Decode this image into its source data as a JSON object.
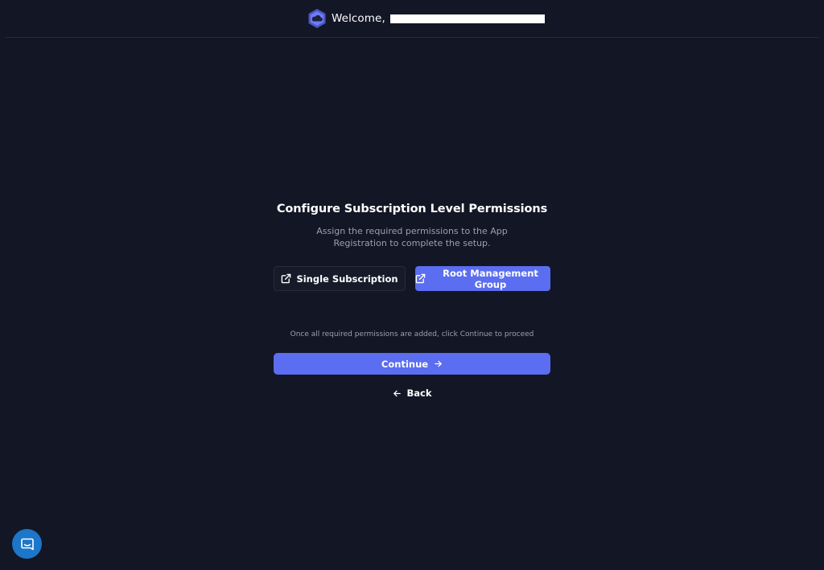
{
  "header": {
    "welcome_label": "Welcome,",
    "username": "",
    "logo_icon": "cloud-hexagon-icon",
    "brand_color": "#5b6df0"
  },
  "main": {
    "title": "Configure Subscription Level Permissions",
    "subtitle": "Assign the required permissions to the App Registration to complete the setup.",
    "options": [
      {
        "label": "Single Subscription",
        "icon": "external-link-icon",
        "active": false
      },
      {
        "label": "Root Management Group",
        "icon": "external-link-icon",
        "active": true
      }
    ],
    "hint": "Once all required permissions are added, click Continue to proceed",
    "continue_label": "Continue",
    "continue_icon": "arrow-right-icon",
    "back_label": "Back",
    "back_icon": "arrow-left-icon"
  },
  "chat": {
    "icon": "chat-bubble-icon",
    "color": "#1c76c9"
  }
}
